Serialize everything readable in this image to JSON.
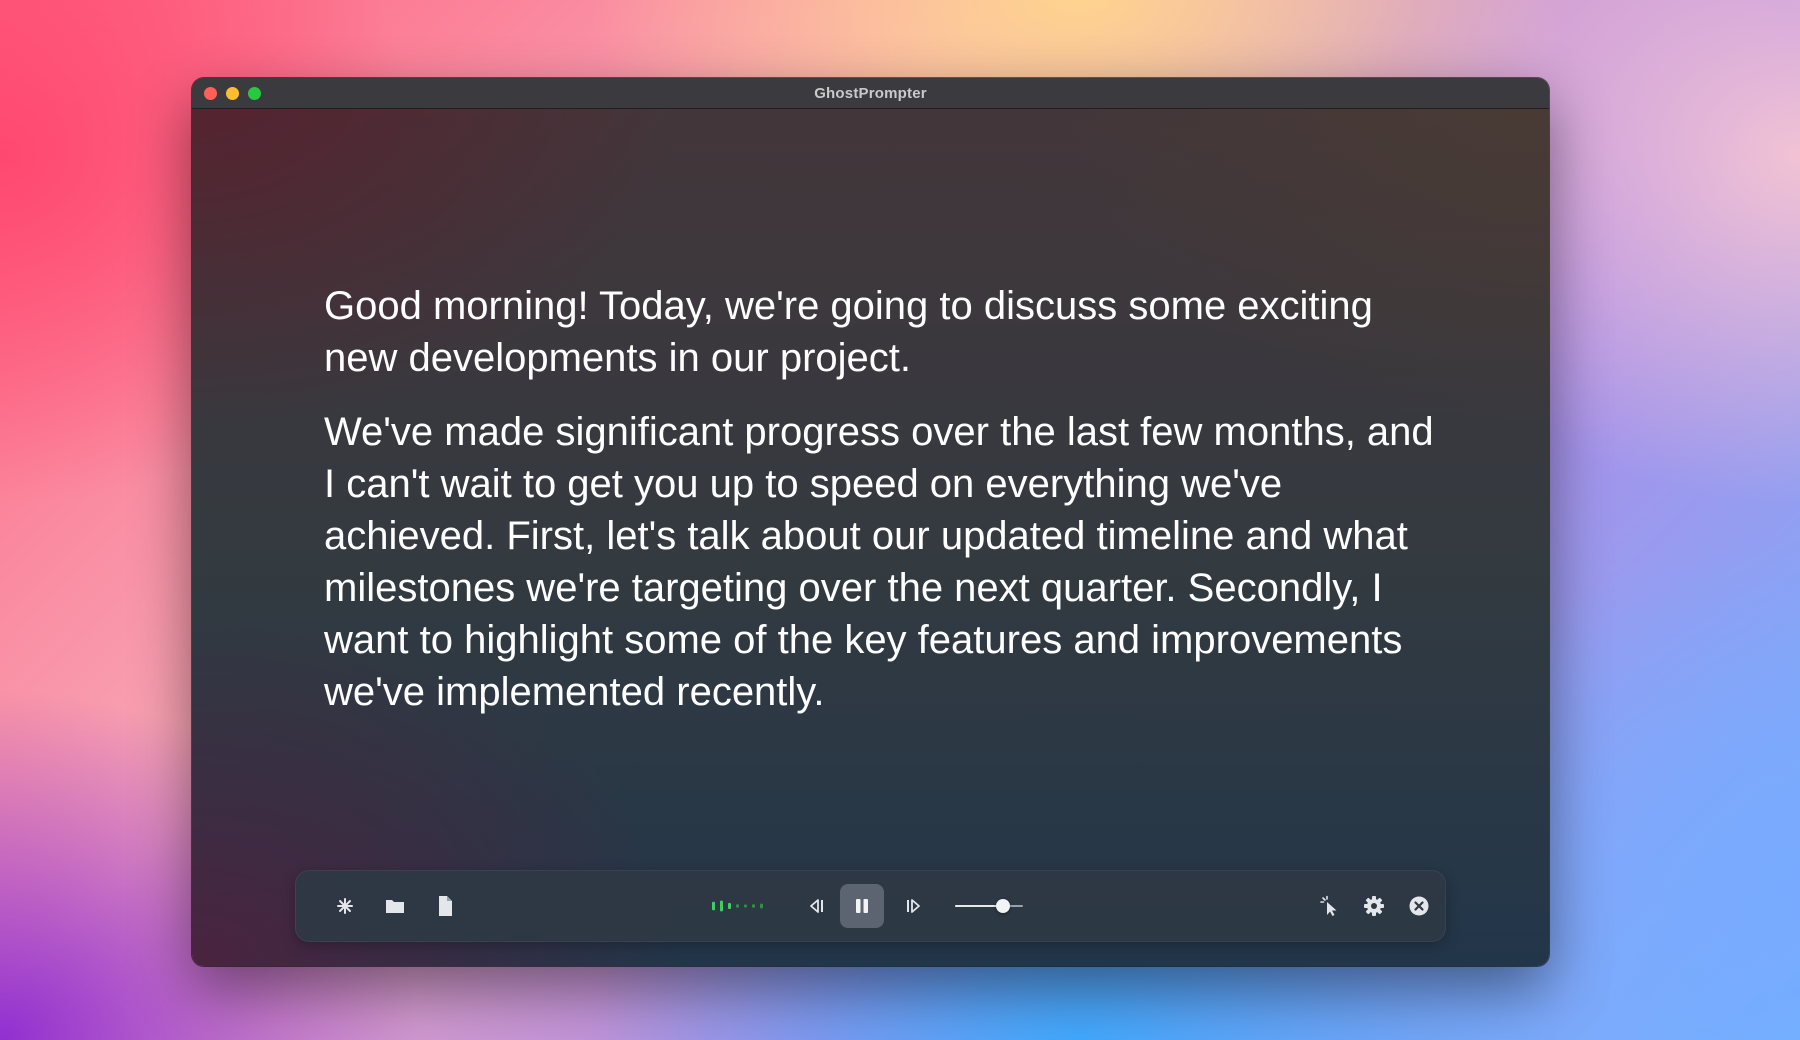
{
  "window": {
    "title": "GhostPrompter"
  },
  "script": {
    "paragraphs": [
      "Good morning! Today, we're going to discuss some exciting new developments in our project.",
      "We've made significant progress over the last few months, and I can't wait to get you up to speed on everything we've achieved. First, let's talk about our updated timeline and what milestones we're targeting over the next quarter. Secondly, I want to highlight some of the key features and improvements we've implemented recently."
    ]
  },
  "toolbar": {
    "left_icons": [
      "sparkle-icon",
      "folder-icon",
      "document-icon"
    ],
    "audio_meter": {
      "levels": [
        0.7,
        0.9,
        0.5,
        0.3,
        0.2,
        0.3,
        0.4
      ],
      "active_color": "#3ecf5c",
      "inactive_color": "#2f8f44"
    },
    "playback": {
      "state": "playing",
      "icons": [
        "rewind-icon",
        "pause-icon",
        "forward-icon"
      ]
    },
    "speed_slider": {
      "value": 0.7
    },
    "right_icons": [
      "cursor-icon",
      "gear-icon",
      "close-circle-icon"
    ]
  },
  "colors": {
    "window_title": "#c9c9cc",
    "script_text": "#ffffff",
    "toolbar_icon": "#e4e6ea"
  }
}
